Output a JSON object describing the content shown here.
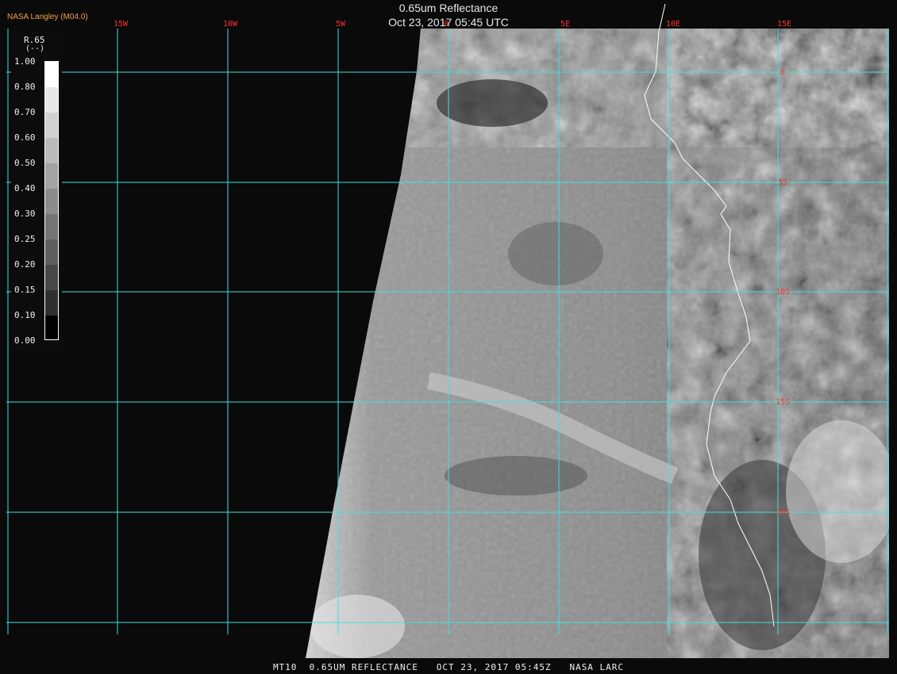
{
  "header": {
    "title": "0.65um Reflectance",
    "timestamp": "Oct 23, 2017 05:45 UTC",
    "agency": "NASA Langley (M04.0)"
  },
  "footer": {
    "caption": "MT10  0.65UM REFLECTANCE   OCT 23, 2017 05:45Z   NASA LARC"
  },
  "legend": {
    "title": "R.65",
    "units": "(--)",
    "levels": [
      "1.00",
      "0.80",
      "0.70",
      "0.60",
      "0.50",
      "0.40",
      "0.30",
      "0.25",
      "0.20",
      "0.15",
      "0.10",
      "0.00"
    ]
  },
  "grid": {
    "line_color": "#40e0e0",
    "label_color": "#ff3030",
    "longitude_labels": [
      "15W",
      "10W",
      "5W",
      "0",
      "5E",
      "10E",
      "15E"
    ],
    "latitude_labels": [
      "0",
      "5S",
      "10S",
      "15S",
      "20S"
    ]
  },
  "colors": {
    "space": "#0a0a0a",
    "coastline": "#ffffff"
  }
}
